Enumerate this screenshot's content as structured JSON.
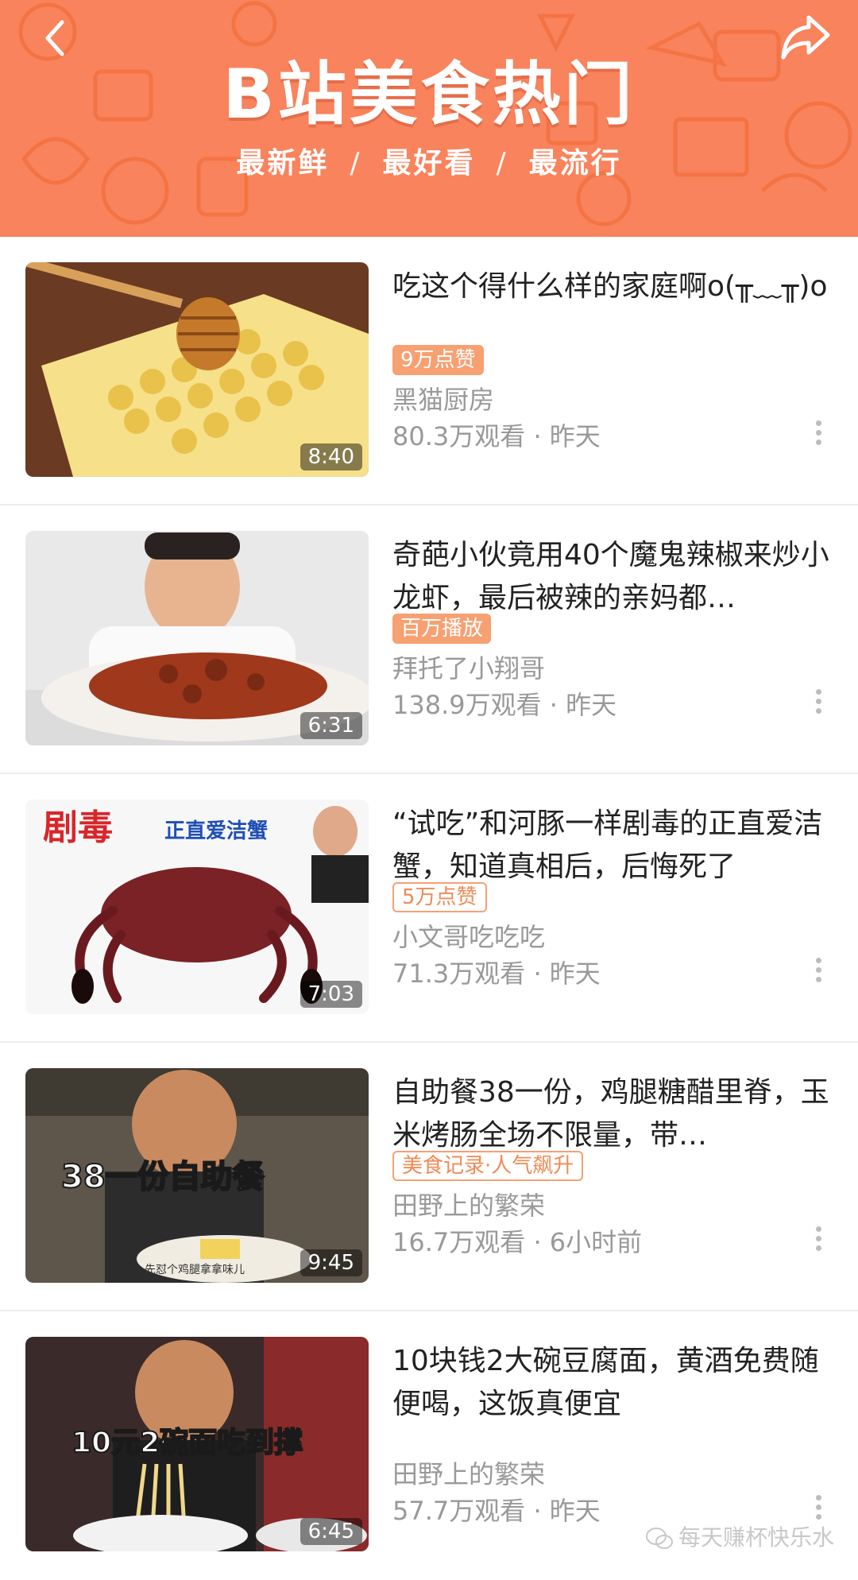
{
  "header": {
    "title": "B站美食热门",
    "subnav": [
      "最新鲜",
      "最好看",
      "最流行"
    ],
    "separator": "/",
    "back_icon": "chevron-left-icon",
    "share_icon": "share-arrow-icon"
  },
  "colors": {
    "header_bg": "#f9835c",
    "badge": "#f7a072",
    "meta_text": "#999999"
  },
  "videos": [
    {
      "title": "吃这个得什么样的家庭啊o(╥﹏╥)o",
      "badge": "9万点赞",
      "badge_style": "filled",
      "author": "黑猫厨房",
      "views": "80.3万观看",
      "time": "昨天",
      "duration": "8:40"
    },
    {
      "title": "奇葩小伙竟用40个魔鬼辣椒来炒小龙虾，最后被辣的亲妈都…",
      "badge": "百万播放",
      "badge_style": "filled",
      "author": "拜托了小翔哥",
      "views": "138.9万观看",
      "time": "昨天",
      "duration": "6:31"
    },
    {
      "title": "“试吃”和河豚一样剧毒的正直爱洁蟹，知道真相后，后悔死了",
      "badge": "5万点赞",
      "badge_style": "outline",
      "author": "小文哥吃吃吃",
      "views": "71.3万观看",
      "time": "昨天",
      "duration": "7:03",
      "thumb_text": [
        "剧毒",
        "正直爱洁蟹"
      ]
    },
    {
      "title": "自助餐38一份，鸡腿糖醋里脊，玉米烤肠全场不限量，带…",
      "badge": "美食记录·人气飙升",
      "badge_style": "outline",
      "author": "田野上的繁荣",
      "views": "16.7万观看",
      "time": "6小时前",
      "duration": "9:45",
      "thumb_text": [
        "38一份自助餐",
        "先怼个鸡腿拿拿味儿"
      ]
    },
    {
      "title": "10块钱2大碗豆腐面，黄酒免费随便喝，这饭真便宜",
      "badge": "",
      "badge_style": "none",
      "author": "田野上的繁荣",
      "views": "57.7万观看",
      "time": "昨天",
      "duration": "6:45",
      "thumb_text": [
        "10元2碗面吃到撑"
      ]
    }
  ],
  "meta_separator": "·",
  "watermark": "每天赚杯快乐水"
}
